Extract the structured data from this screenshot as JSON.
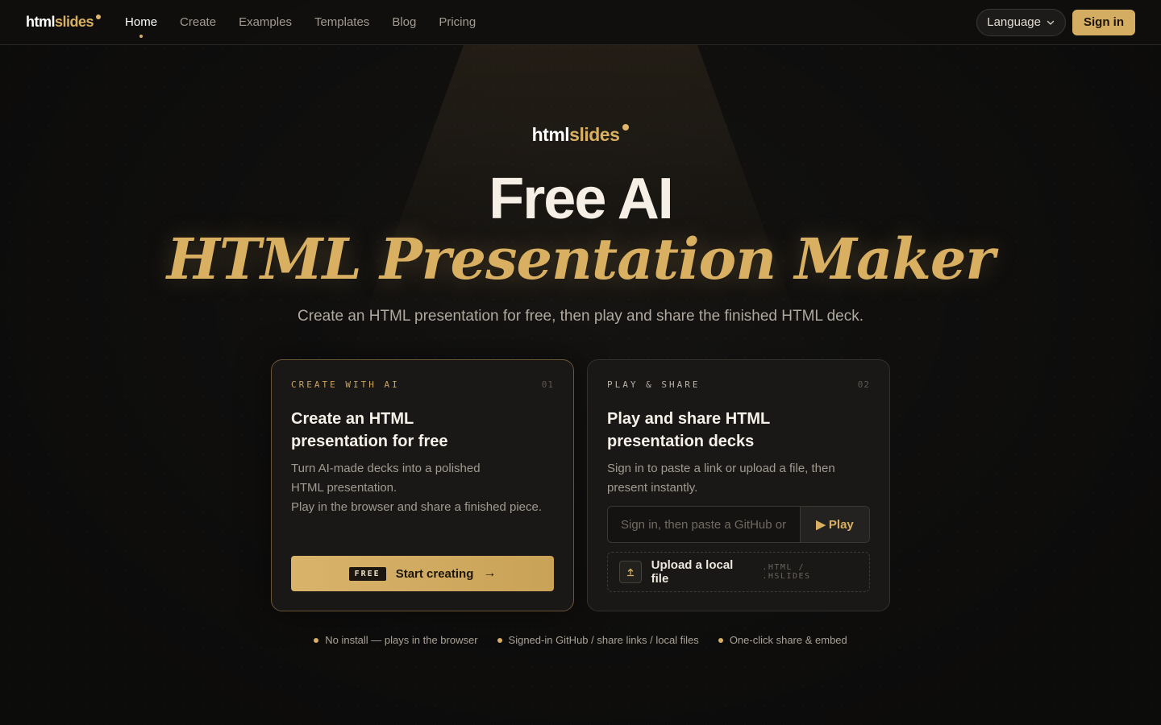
{
  "nav": {
    "logo": {
      "part1": "html",
      "part2": "slides"
    },
    "links": [
      "Home",
      "Create",
      "Examples",
      "Templates",
      "Blog",
      "Pricing"
    ],
    "language_label": "Language",
    "signin_label": "Sign in"
  },
  "hero": {
    "logo": {
      "part1": "html",
      "part2": "slides"
    },
    "title_line1": "Free AI",
    "title_line2": "HTML Presentation Maker",
    "subtitle": "Create an HTML presentation for free, then play and share the finished HTML deck."
  },
  "cards": {
    "create": {
      "eyebrow": "CREATE WITH AI",
      "number": "01",
      "title": "Create an HTML presentation for free",
      "desc_line1": "Turn AI-made decks into a polished",
      "desc_line2": "HTML presentation.",
      "desc_line3": "Play in the browser and share a finished piece.",
      "cta_tag": "FREE",
      "cta_label": "Start creating",
      "cta_arrow": "→"
    },
    "play": {
      "eyebrow": "PLAY & SHARE",
      "number": "02",
      "title": "Play and share HTML presentation decks",
      "desc": "Sign in to paste a link or upload a file, then present instantly.",
      "input_placeholder": "Sign in, then paste a GitHub or",
      "play_label": "▶ Play",
      "upload_icon": "upload-icon",
      "upload_label": "Upload a local file",
      "upload_ext": ".HTML / .HSLIDES"
    }
  },
  "features": [
    "No install — plays in the browser",
    "Signed-in GitHub / share links / local files",
    "One-click share & embed"
  ],
  "colors": {
    "accent": "#d9b061",
    "background": "#131211"
  }
}
